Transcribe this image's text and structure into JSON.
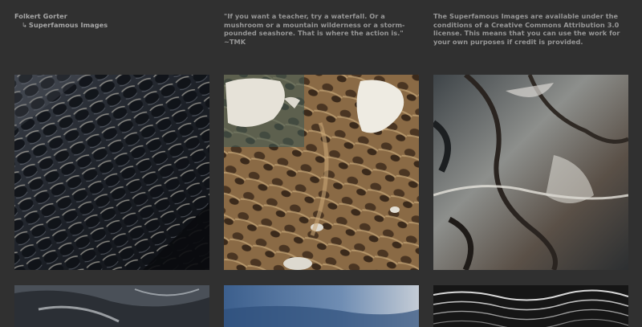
{
  "header": {
    "author": "Folkert Gorter",
    "site_link_arrow": "↳",
    "site_link": "Superfamous Images",
    "quote": "\"If you want a teacher, try a waterfall. Or a mushroom or a mountain wilderness or a storm-pounded seashore. That is where the action is.\" ~TMK",
    "license": "The Superfamous Images are available under the conditions of a Creative Commons Attribution 3.0 license. This means that you can use the work for your own purposes if credit is provided."
  },
  "colors": {
    "background": "#303030",
    "text": "#9a9a9a"
  }
}
